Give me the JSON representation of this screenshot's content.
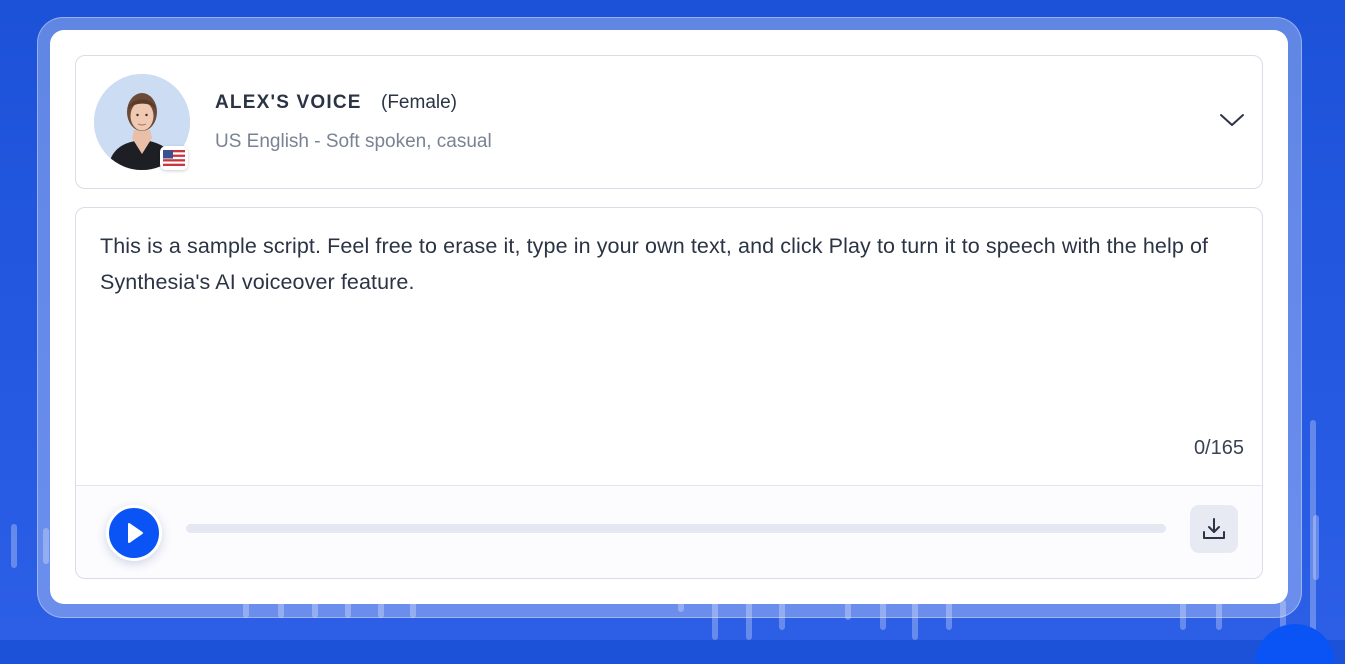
{
  "voice": {
    "name": "ALEX'S VOICE",
    "gender": "(Female)",
    "description": "US English - Soft spoken, casual",
    "flag_icon": "us-flag-icon",
    "expand_icon": "chevron-down-icon"
  },
  "script": {
    "text": "This is a sample script. Feel free to erase it, type in your own text, and click Play to turn it to speech with the help of Synthesia's AI voiceover feature.",
    "char_count": "0/165"
  },
  "player": {
    "play_icon": "play-icon",
    "download_icon": "download-icon",
    "progress": 0
  },
  "colors": {
    "accent": "#0a54f5",
    "background": "#1f56de",
    "text_primary": "#2b3445",
    "text_secondary": "#7a8394"
  }
}
